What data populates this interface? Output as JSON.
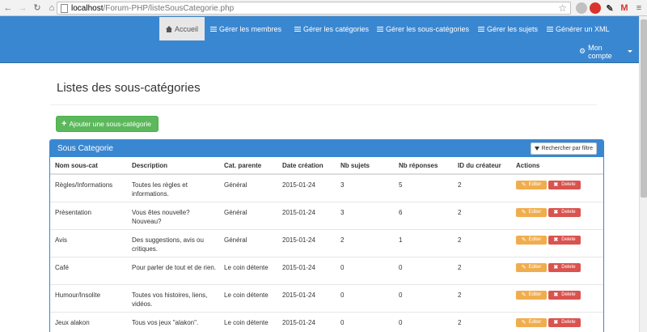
{
  "browser": {
    "url_host": "localhost",
    "url_path": "/Forum-PHP/listeSousCategorie.php"
  },
  "navbar": {
    "items": [
      {
        "label": "Accueil",
        "icon": "home-icon",
        "active": true
      },
      {
        "label": "Gérer les membres",
        "icon": "list-icon"
      },
      {
        "label": "Gérer les catégories",
        "icon": "list-icon"
      },
      {
        "label": "Gérer les sous-catégories",
        "icon": "list-icon"
      },
      {
        "label": "Gérer les sujets",
        "icon": "list-icon"
      },
      {
        "label": "Générer un XML",
        "icon": "database-icon"
      }
    ],
    "account_label": "Mon compte"
  },
  "page": {
    "title": "Listes des sous-catégories",
    "add_button": "Ajouter une sous-catégorie"
  },
  "panel": {
    "title": "Sous Categorie",
    "filter_button": "Rechercher par filtre",
    "columns": [
      "Nom sous-cat",
      "Description",
      "Cat. parente",
      "Date création",
      "Nb sujets",
      "Nb réponses",
      "ID du créateur",
      "Actions"
    ],
    "edit_label": "Editer",
    "delete_label": "Delete",
    "rows": [
      {
        "name": "Règles/Informations",
        "desc": "Toutes les règles et informations.",
        "parent": "Général",
        "date": "2015-01-24",
        "topics": "3",
        "replies": "5",
        "creator": "2"
      },
      {
        "name": "Présentation",
        "desc": "Vous êtes nouvelle? Nouveau?",
        "parent": "Général",
        "date": "2015-01-24",
        "topics": "3",
        "replies": "6",
        "creator": "2"
      },
      {
        "name": "Avis",
        "desc": "Des suggestions, avis ou critiques.",
        "parent": "Général",
        "date": "2015-01-24",
        "topics": "2",
        "replies": "1",
        "creator": "2"
      },
      {
        "name": "Café",
        "desc": "Pour parler de tout et de rien.",
        "parent": "Le coin détente",
        "date": "2015-01-24",
        "topics": "0",
        "replies": "0",
        "creator": "2"
      },
      {
        "name": "Humour/Insolite",
        "desc": "Toutes vos histoires, liens, vidéos.",
        "parent": "Le coin détente",
        "date": "2015-01-24",
        "topics": "0",
        "replies": "0",
        "creator": "2"
      },
      {
        "name": "Jeux alakon",
        "desc": "Tous vos jeux \"alakon\".",
        "parent": "Le coin détente",
        "date": "2015-01-24",
        "topics": "0",
        "replies": "0",
        "creator": "2"
      }
    ]
  },
  "colors": {
    "navbar": "#3a87d1",
    "success": "#5cb85c",
    "warning": "#f0ad4e",
    "danger": "#d9534f"
  }
}
